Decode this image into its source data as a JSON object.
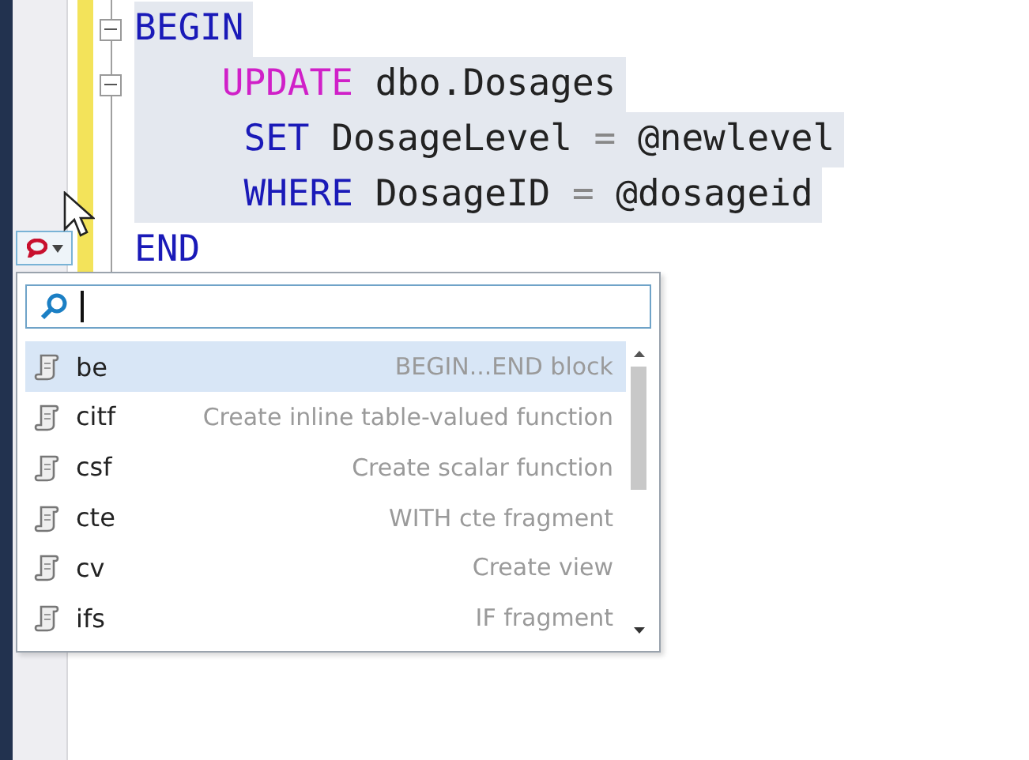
{
  "editor": {
    "lines": [
      {
        "fold": true,
        "tokens": [
          {
            "text": "BEGIN",
            "kind": "keyword"
          }
        ]
      },
      {
        "fold": true,
        "tokens": [
          {
            "text": "    UPDATE",
            "kind": "function"
          },
          {
            "text": " dbo.Dosages",
            "kind": "plain"
          }
        ]
      },
      {
        "fold": false,
        "tokens": [
          {
            "text": "     SET",
            "kind": "keyword"
          },
          {
            "text": " DosageLevel ",
            "kind": "plain"
          },
          {
            "text": "=",
            "kind": "operator"
          },
          {
            "text": " @newlevel",
            "kind": "plain"
          }
        ]
      },
      {
        "fold": false,
        "tokens": [
          {
            "text": "     WHERE",
            "kind": "keyword"
          },
          {
            "text": " DosageID ",
            "kind": "plain"
          },
          {
            "text": "=",
            "kind": "operator"
          },
          {
            "text": " @dosageid",
            "kind": "plain"
          }
        ]
      },
      {
        "fold": false,
        "tokens": [
          {
            "text": "END",
            "kind": "keyword"
          }
        ]
      }
    ]
  },
  "snippet_popup": {
    "items": [
      {
        "shortcut": "be",
        "description": "BEGIN...END block",
        "selected": true
      },
      {
        "shortcut": "citf",
        "description": "Create inline table-valued function",
        "selected": false
      },
      {
        "shortcut": "csf",
        "description": "Create scalar function",
        "selected": false
      },
      {
        "shortcut": "cte",
        "description": "WITH cte fragment",
        "selected": false
      },
      {
        "shortcut": "cv",
        "description": "Create view",
        "selected": false
      },
      {
        "shortcut": "ifs",
        "description": "IF fragment",
        "selected": false
      }
    ]
  }
}
